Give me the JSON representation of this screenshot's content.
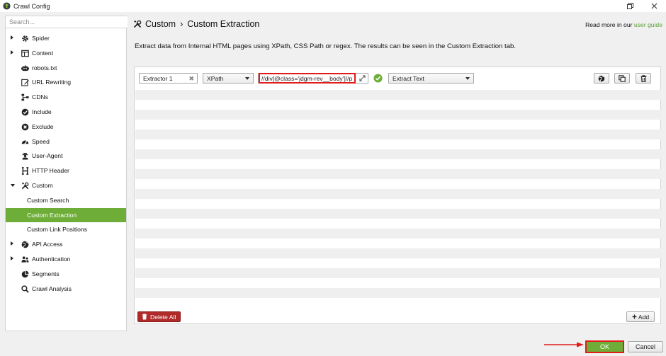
{
  "window": {
    "title": "Crawl Config"
  },
  "sidebar": {
    "search_placeholder": "Search...",
    "items": [
      {
        "label": "Spider",
        "expander": "right",
        "icon": "gear-icon"
      },
      {
        "label": "Content",
        "expander": "right",
        "icon": "content-icon"
      },
      {
        "label": "robots.txt",
        "expander": "",
        "icon": "robot-icon"
      },
      {
        "label": "URL Rewriting",
        "expander": "",
        "icon": "edit-icon"
      },
      {
        "label": "CDNs",
        "expander": "",
        "icon": "network-icon"
      },
      {
        "label": "Include",
        "expander": "",
        "icon": "check-circle-icon"
      },
      {
        "label": "Exclude",
        "expander": "",
        "icon": "x-circle-icon"
      },
      {
        "label": "Speed",
        "expander": "",
        "icon": "speedometer-icon"
      },
      {
        "label": "User-Agent",
        "expander": "",
        "icon": "user-secret-icon"
      },
      {
        "label": "HTTP Header",
        "expander": "",
        "icon": "heading-icon"
      },
      {
        "label": "Custom",
        "expander": "down",
        "icon": "tools-icon"
      },
      {
        "label": "Custom Search",
        "sub": true
      },
      {
        "label": "Custom Extraction",
        "sub": true,
        "active": true
      },
      {
        "label": "Custom Link Positions",
        "sub": true
      },
      {
        "label": "API Access",
        "expander": "right",
        "icon": "globe-icon"
      },
      {
        "label": "Authentication",
        "expander": "right",
        "icon": "users-icon"
      },
      {
        "label": "Segments",
        "expander": "",
        "icon": "pie-chart-icon"
      },
      {
        "label": "Crawl Analysis",
        "expander": "",
        "icon": "search-icon"
      }
    ]
  },
  "header": {
    "breadcrumb_parent": "Custom",
    "breadcrumb_separator": "›",
    "breadcrumb_current": "Custom Extraction",
    "read_more_text": "Read more in our",
    "read_more_link": "user guide",
    "description": "Extract data from Internal HTML pages using XPath, CSS Path or regex. The results can be seen in the Custom Extraction tab."
  },
  "extractor": {
    "name": "Extractor 1",
    "type": "XPath",
    "expression": "//div[@class='jdgm-rev__body']//p",
    "extract_mode": "Extract Text"
  },
  "panel": {
    "delete_all_label": "Delete All",
    "add_label": "Add"
  },
  "footer": {
    "ok_label": "OK",
    "cancel_label": "Cancel"
  },
  "colors": {
    "accent_green": "#6eae38",
    "danger_red": "#b02a2a",
    "highlight_red": "#e21a1a"
  }
}
